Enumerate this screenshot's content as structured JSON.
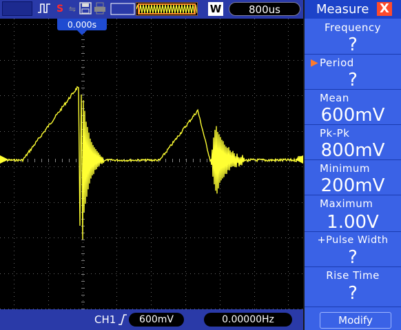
{
  "topbar": {
    "timebase": "800us",
    "w_label": "W",
    "stop_icon": "S"
  },
  "screen": {
    "trigger_time": "0.000s"
  },
  "bottombar": {
    "channel": "CH1",
    "volts_per_div": "600mV",
    "frequency": "0.00000Hz"
  },
  "measure_panel": {
    "title": "Measure",
    "close_label": "X",
    "items": [
      {
        "label": "Frequency",
        "value": "?"
      },
      {
        "label": "Period",
        "value": "?"
      },
      {
        "label": "Mean",
        "value": "600mV"
      },
      {
        "label": "Pk-Pk",
        "value": "800mV"
      },
      {
        "label": "Minimum",
        "value": "200mV"
      },
      {
        "label": "Maximum",
        "value": "1.00V"
      },
      {
        "label": "+Pulse Width",
        "value": "?"
      },
      {
        "label": "Rise Time",
        "value": "?"
      }
    ],
    "selected": "Period",
    "modify_label": "Modify"
  },
  "colors": {
    "trace": "#ffff33",
    "panel": "#3a62e6",
    "bar": "#2a3aa8"
  }
}
